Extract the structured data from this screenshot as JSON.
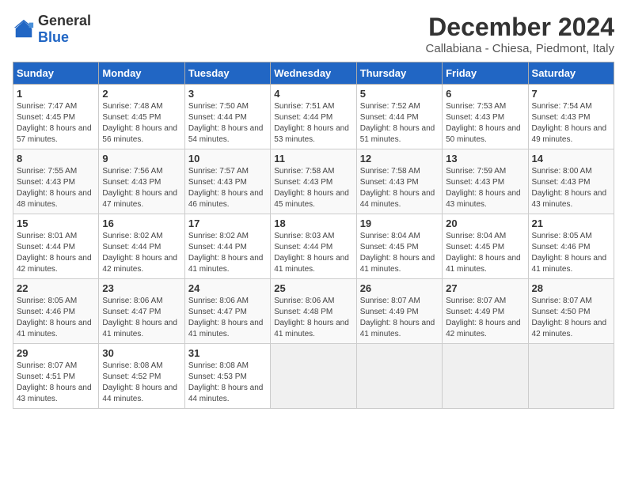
{
  "logo": {
    "general": "General",
    "blue": "Blue"
  },
  "title": "December 2024",
  "subtitle": "Callabiana - Chiesa, Piedmont, Italy",
  "headers": [
    "Sunday",
    "Monday",
    "Tuesday",
    "Wednesday",
    "Thursday",
    "Friday",
    "Saturday"
  ],
  "weeks": [
    [
      {
        "day": "1",
        "sunrise": "7:47 AM",
        "sunset": "4:45 PM",
        "daylight": "8 hours and 57 minutes."
      },
      {
        "day": "2",
        "sunrise": "7:48 AM",
        "sunset": "4:45 PM",
        "daylight": "8 hours and 56 minutes."
      },
      {
        "day": "3",
        "sunrise": "7:50 AM",
        "sunset": "4:44 PM",
        "daylight": "8 hours and 54 minutes."
      },
      {
        "day": "4",
        "sunrise": "7:51 AM",
        "sunset": "4:44 PM",
        "daylight": "8 hours and 53 minutes."
      },
      {
        "day": "5",
        "sunrise": "7:52 AM",
        "sunset": "4:44 PM",
        "daylight": "8 hours and 51 minutes."
      },
      {
        "day": "6",
        "sunrise": "7:53 AM",
        "sunset": "4:43 PM",
        "daylight": "8 hours and 50 minutes."
      },
      {
        "day": "7",
        "sunrise": "7:54 AM",
        "sunset": "4:43 PM",
        "daylight": "8 hours and 49 minutes."
      }
    ],
    [
      {
        "day": "8",
        "sunrise": "7:55 AM",
        "sunset": "4:43 PM",
        "daylight": "8 hours and 48 minutes."
      },
      {
        "day": "9",
        "sunrise": "7:56 AM",
        "sunset": "4:43 PM",
        "daylight": "8 hours and 47 minutes."
      },
      {
        "day": "10",
        "sunrise": "7:57 AM",
        "sunset": "4:43 PM",
        "daylight": "8 hours and 46 minutes."
      },
      {
        "day": "11",
        "sunrise": "7:58 AM",
        "sunset": "4:43 PM",
        "daylight": "8 hours and 45 minutes."
      },
      {
        "day": "12",
        "sunrise": "7:58 AM",
        "sunset": "4:43 PM",
        "daylight": "8 hours and 44 minutes."
      },
      {
        "day": "13",
        "sunrise": "7:59 AM",
        "sunset": "4:43 PM",
        "daylight": "8 hours and 43 minutes."
      },
      {
        "day": "14",
        "sunrise": "8:00 AM",
        "sunset": "4:43 PM",
        "daylight": "8 hours and 43 minutes."
      }
    ],
    [
      {
        "day": "15",
        "sunrise": "8:01 AM",
        "sunset": "4:44 PM",
        "daylight": "8 hours and 42 minutes."
      },
      {
        "day": "16",
        "sunrise": "8:02 AM",
        "sunset": "4:44 PM",
        "daylight": "8 hours and 42 minutes."
      },
      {
        "day": "17",
        "sunrise": "8:02 AM",
        "sunset": "4:44 PM",
        "daylight": "8 hours and 41 minutes."
      },
      {
        "day": "18",
        "sunrise": "8:03 AM",
        "sunset": "4:44 PM",
        "daylight": "8 hours and 41 minutes."
      },
      {
        "day": "19",
        "sunrise": "8:04 AM",
        "sunset": "4:45 PM",
        "daylight": "8 hours and 41 minutes."
      },
      {
        "day": "20",
        "sunrise": "8:04 AM",
        "sunset": "4:45 PM",
        "daylight": "8 hours and 41 minutes."
      },
      {
        "day": "21",
        "sunrise": "8:05 AM",
        "sunset": "4:46 PM",
        "daylight": "8 hours and 41 minutes."
      }
    ],
    [
      {
        "day": "22",
        "sunrise": "8:05 AM",
        "sunset": "4:46 PM",
        "daylight": "8 hours and 41 minutes."
      },
      {
        "day": "23",
        "sunrise": "8:06 AM",
        "sunset": "4:47 PM",
        "daylight": "8 hours and 41 minutes."
      },
      {
        "day": "24",
        "sunrise": "8:06 AM",
        "sunset": "4:47 PM",
        "daylight": "8 hours and 41 minutes."
      },
      {
        "day": "25",
        "sunrise": "8:06 AM",
        "sunset": "4:48 PM",
        "daylight": "8 hours and 41 minutes."
      },
      {
        "day": "26",
        "sunrise": "8:07 AM",
        "sunset": "4:49 PM",
        "daylight": "8 hours and 41 minutes."
      },
      {
        "day": "27",
        "sunrise": "8:07 AM",
        "sunset": "4:49 PM",
        "daylight": "8 hours and 42 minutes."
      },
      {
        "day": "28",
        "sunrise": "8:07 AM",
        "sunset": "4:50 PM",
        "daylight": "8 hours and 42 minutes."
      }
    ],
    [
      {
        "day": "29",
        "sunrise": "8:07 AM",
        "sunset": "4:51 PM",
        "daylight": "8 hours and 43 minutes."
      },
      {
        "day": "30",
        "sunrise": "8:08 AM",
        "sunset": "4:52 PM",
        "daylight": "8 hours and 44 minutes."
      },
      {
        "day": "31",
        "sunrise": "8:08 AM",
        "sunset": "4:53 PM",
        "daylight": "8 hours and 44 minutes."
      },
      null,
      null,
      null,
      null
    ]
  ],
  "labels": {
    "sunrise": "Sunrise:",
    "sunset": "Sunset:",
    "daylight": "Daylight:"
  }
}
